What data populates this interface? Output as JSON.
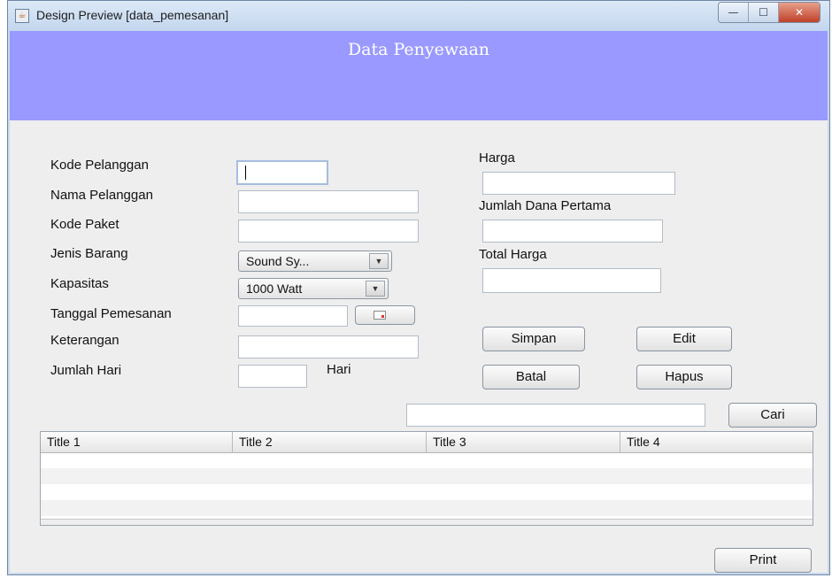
{
  "window": {
    "title": "Design Preview [data_pemesanan]",
    "controls": {
      "minimize": "—",
      "maximize": "☐",
      "close": "✕"
    }
  },
  "header": {
    "title": "Data Penyewaan",
    "background": "#9999ff"
  },
  "form": {
    "kode_pelanggan": {
      "label": "Kode Pelanggan",
      "value": ""
    },
    "nama_pelanggan": {
      "label": "Nama Pelanggan",
      "value": ""
    },
    "kode_paket": {
      "label": "Kode Paket",
      "value": ""
    },
    "jenis_barang": {
      "label": "Jenis Barang",
      "value": "Sound Sy..."
    },
    "kapasitas": {
      "label": "Kapasitas",
      "value": "1000 Watt"
    },
    "tanggal_pemesanan": {
      "label": "Tanggal Pemesanan",
      "value": ""
    },
    "keterangan": {
      "label": "Keterangan",
      "value": ""
    },
    "jumlah_hari": {
      "label": "Jumlah Hari",
      "value": "",
      "unit": "Hari"
    },
    "harga": {
      "label": "Harga",
      "value": ""
    },
    "jumlah_dana_pertama": {
      "label": "Jumlah Dana Pertama",
      "value": ""
    },
    "total_harga": {
      "label": "Total Harga",
      "value": ""
    }
  },
  "buttons": {
    "simpan": "Simpan",
    "edit": "Edit",
    "batal": "Batal",
    "hapus": "Hapus",
    "cari": "Cari",
    "print": "Print"
  },
  "search": {
    "value": ""
  },
  "table": {
    "columns": [
      "Title 1",
      "Title 2",
      "Title 3",
      "Title 4"
    ],
    "rows": [
      [
        "",
        "",
        "",
        ""
      ],
      [
        "",
        "",
        "",
        ""
      ],
      [
        "",
        "",
        "",
        ""
      ],
      [
        "",
        "",
        "",
        ""
      ]
    ]
  },
  "icons": {
    "app": "java-cup-icon",
    "dropdown": "dropdown-arrow-icon",
    "calendar": "calendar-icon"
  }
}
